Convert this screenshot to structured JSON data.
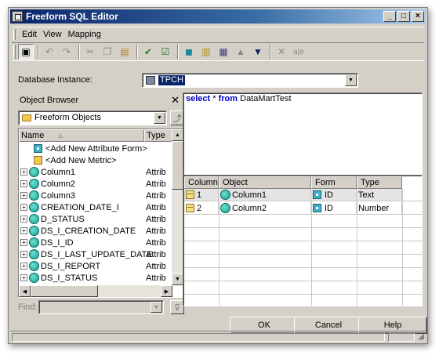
{
  "window": {
    "title": "Freeform SQL Editor"
  },
  "menu": {
    "edit": "Edit",
    "view": "View",
    "mapping": "Mapping"
  },
  "database": {
    "label": "Database Instance:",
    "value": "TPCH"
  },
  "object_browser": {
    "title": "Object Browser",
    "folder": "Freeform Objects",
    "col_name": "Name",
    "col_type": "Type",
    "items": [
      {
        "name": "<Add New Attribute Form>",
        "type": "",
        "icon": "form"
      },
      {
        "name": "<Add New Metric>",
        "type": "",
        "icon": "metric"
      },
      {
        "name": "Column1",
        "type": "Attrib"
      },
      {
        "name": "Column2",
        "type": "Attrib"
      },
      {
        "name": "Column3",
        "type": "Attrib"
      },
      {
        "name": "CREATION_DATE_I",
        "type": "Attrib"
      },
      {
        "name": "D_STATUS",
        "type": "Attrib"
      },
      {
        "name": "DS_I_CREATION_DATE",
        "type": "Attrib"
      },
      {
        "name": "DS_I_ID",
        "type": "Attrib"
      },
      {
        "name": "DS_I_LAST_UPDATE_DATE",
        "type": "Attrib"
      },
      {
        "name": "DS_I_REPORT",
        "type": "Attrib"
      },
      {
        "name": "DS_I_STATUS",
        "type": "Attrib"
      }
    ],
    "find_label": "Find:"
  },
  "sql": {
    "kw1": "select",
    "star": "*",
    "kw2": "from",
    "table": "DataMartTest"
  },
  "grid": {
    "headers": [
      "Column",
      "Object",
      "Form",
      "Type"
    ],
    "rows": [
      {
        "column": "1",
        "object": "Column1",
        "form": "ID",
        "type": "Text"
      },
      {
        "column": "2",
        "object": "Column2",
        "form": "ID",
        "type": "Number"
      }
    ]
  },
  "buttons": {
    "ok": "OK",
    "cancel": "Cancel",
    "help": "Help"
  }
}
